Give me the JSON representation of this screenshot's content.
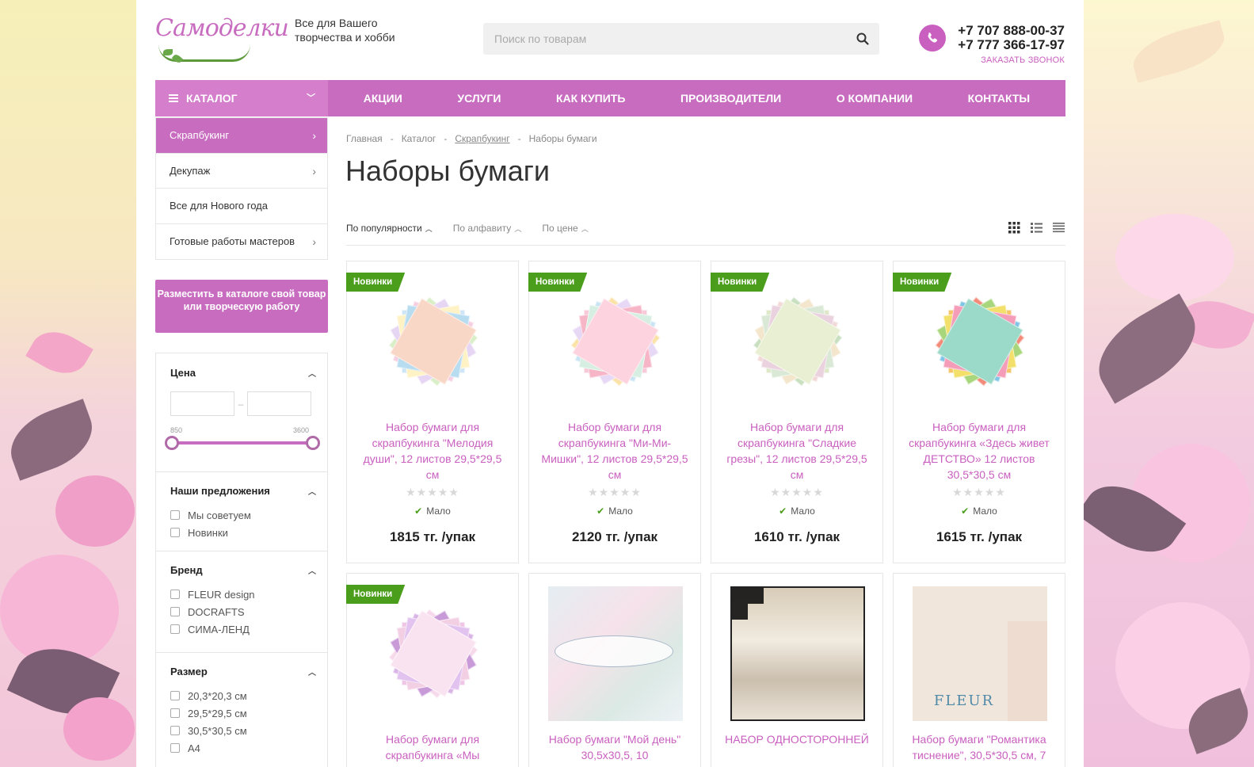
{
  "header": {
    "logo_text": "Самоделки",
    "tagline": "Все для Вашего творчества и хобби",
    "search_placeholder": "Поиск по товарам",
    "phones": [
      "+7 707 888-00-37",
      "+7 777 366-17-97"
    ],
    "callback": "ЗАКАЗАТЬ ЗВОНОК"
  },
  "nav": {
    "catalog": "КАТАЛОГ",
    "items": [
      "АКЦИИ",
      "УСЛУГИ",
      "КАК КУПИТЬ",
      "ПРОИЗВОДИТЕЛИ",
      "О КОМПАНИИ",
      "КОНТАКТЫ"
    ]
  },
  "sidebar": {
    "items": [
      "Скрапбукинг",
      "Декупаж",
      "Все для Нового года",
      "Готовые работы мастеров"
    ],
    "place_button": "Разместить в каталоге свой товар или творческую работу"
  },
  "filters": {
    "price_title": "Цена",
    "price_min": "850",
    "price_max": "3600",
    "offers_title": "Наши предложения",
    "offers": [
      "Мы советуем",
      "Новинки"
    ],
    "brand_title": "Бренд",
    "brands": [
      "FLEUR design",
      "DOCRAFTS",
      "СИМА-ЛЕНД"
    ],
    "size_title": "Размер",
    "sizes": [
      "20,3*20,3 см",
      "29,5*29,5 см",
      "30,5*30,5 см",
      "А4"
    ]
  },
  "breadcrumb": [
    "Главная",
    "Каталог",
    "Скрапбукинг",
    "Наборы бумаги"
  ],
  "page_title": "Наборы бумаги",
  "sort": [
    "По популярности",
    "По алфавиту",
    "По цене"
  ],
  "products": [
    {
      "badge": "Новинки",
      "title": "Набор бумаги для скрапбукинга \"Мелодия души\", 12 листов 29,5*29,5 см",
      "stock": "Мало",
      "price": "1815 тг. /упак"
    },
    {
      "badge": "Новинки",
      "title": "Набор бумаги для скрапбукинга \"Ми-Ми-Мишки\", 12 листов 29,5*29,5 см",
      "stock": "Мало",
      "price": "2120 тг. /упак"
    },
    {
      "badge": "Новинки",
      "title": "Набор бумаги для скрапбукинга \"Сладкие грезы\", 12 листов 29,5*29,5 см",
      "stock": "Мало",
      "price": "1610 тг. /упак"
    },
    {
      "badge": "Новинки",
      "title": "Набор бумаги для скрапбукинга «Здесь живет ДЕТСТВО» 12 листов 30,5*30,5 см",
      "stock": "Мало",
      "price": "1615 тг. /упак"
    },
    {
      "badge": "Новинки",
      "title": "Набор бумаги для скрапбукинга «Мы",
      "stock": "",
      "price": ""
    },
    {
      "badge": "",
      "title": "Набор бумаги \"Мой день\" 30,5х30,5, 10",
      "stock": "",
      "price": ""
    },
    {
      "badge": "",
      "title": "НАБОР ОДНОСТОРОННЕЙ",
      "stock": "",
      "price": ""
    },
    {
      "badge": "",
      "title": "Набор бумаги \"Романтика тиснение\", 30,5*30,5 см, 7",
      "stock": "",
      "price": ""
    }
  ],
  "stars": "★★★★★",
  "check": "✔",
  "colors": {
    "accent": "#c86cc0",
    "badge": "#4b9e1c"
  }
}
